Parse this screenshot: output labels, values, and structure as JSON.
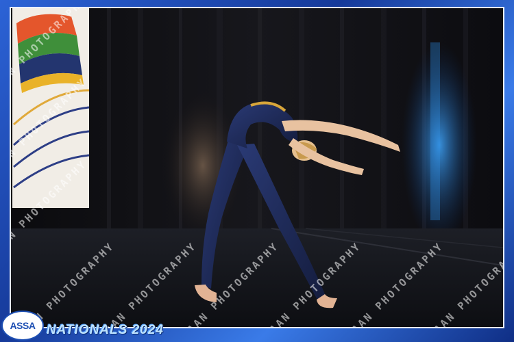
{
  "photo": {
    "subject": "dancer in dark blue unitard performing a backbend on stage",
    "icons": [
      "dancer-figure",
      "stage-curtain",
      "banner-flag",
      "spotlight"
    ]
  },
  "watermark": {
    "text": "IRENAAN PHOTOGRAPHY"
  },
  "footer": {
    "logo_text": "ASSA",
    "event_title": "NATIONALS 2024"
  },
  "colors": {
    "frame_blue": "#1f4fb8",
    "unitard": "#1c2a55",
    "curtain": "#141419",
    "title_text": "#bfe3ff"
  }
}
